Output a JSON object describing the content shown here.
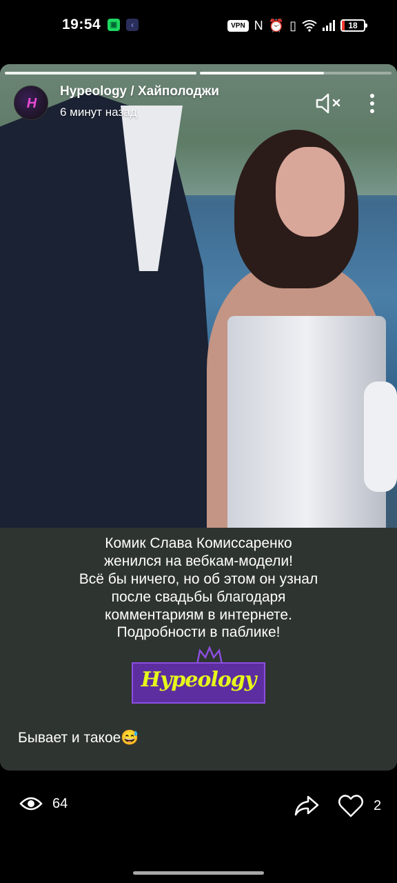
{
  "status_bar": {
    "time": "19:54",
    "vpn": "VPN",
    "battery": "18",
    "icons": [
      "app-notification-icon",
      "app-notification-icon-2",
      "vpn-icon",
      "nfc-icon",
      "alarm-icon",
      "vibrate-icon",
      "wifi-icon",
      "signal-icon",
      "battery-icon"
    ]
  },
  "story": {
    "progress": [
      1.0,
      0.65
    ],
    "author": "Hypeology / Хайполоджи",
    "time_ago": "6 минут назад",
    "headline_lines": [
      "Комик Слава Комиссаренко",
      "женился на вебкам-модели!",
      "Всё бы ничего, но об этом он узнал",
      "после свадьбы благодаря",
      "комментариям в интернете."
    ],
    "subline": "Подробности в паблике!",
    "logo_text": "Hypeology",
    "comment": "Бывает и такое😅"
  },
  "actions": {
    "views": "64",
    "likes": "2"
  },
  "colors": {
    "card_bg": "#2e3430",
    "logo_bg": "#5d2ea0",
    "logo_text": "#e6f71b"
  }
}
